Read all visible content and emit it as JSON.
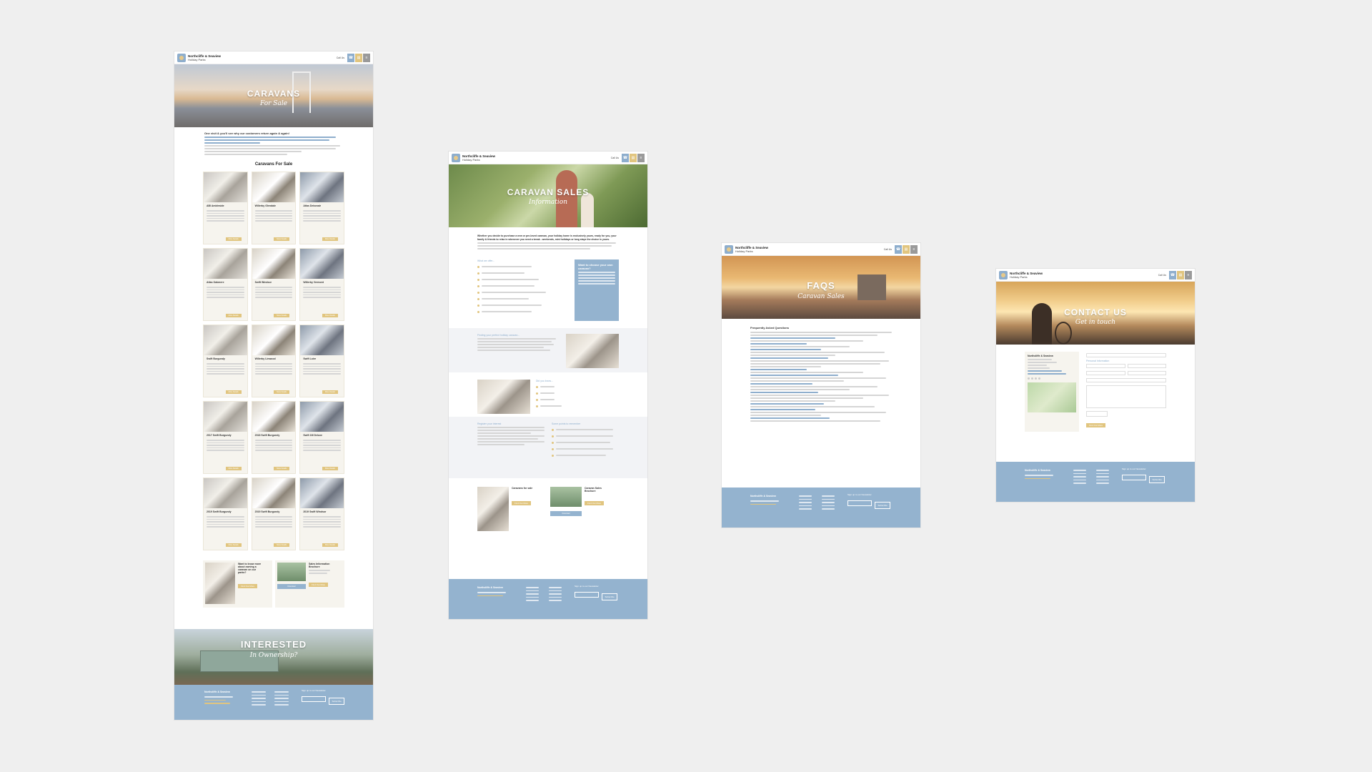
{
  "brand": {
    "name": "Northcliffe & Seaview",
    "sub": "Holiday Parks",
    "phone": "Call Us"
  },
  "icons": {
    "phone": "phone-icon",
    "brochure": "book-icon",
    "menu": "menu-icon"
  },
  "colors": {
    "blue": "#94b3cf",
    "gold": "#e1c57f",
    "grey": "#9a9a9a"
  },
  "board1": {
    "hero_title": "CARAVANS",
    "hero_script": "For Sale",
    "intro_heading": "One visit & you'll see why our customers return again & again!",
    "section_title": "Caravans For Sale",
    "cards": [
      {
        "name": "ABI Ambleside"
      },
      {
        "name": "Willerby Glendale"
      },
      {
        "name": "Atlas Debonair"
      },
      {
        "name": "Atlas Oakmere"
      },
      {
        "name": "Swift Windsor"
      },
      {
        "name": "Willerby Vermont"
      },
      {
        "name": "Swift Burgundy"
      },
      {
        "name": "Willerby Linwood"
      },
      {
        "name": "Swift Loire"
      },
      {
        "name": "2017 Swift Burgundy"
      },
      {
        "name": "2018 Swift Burgundy"
      },
      {
        "name": "Swift 1M Deluxe"
      },
      {
        "name": "2019 Swift Burgundy"
      },
      {
        "name": "2019 Swift Burgundy"
      },
      {
        "name": "2019 Swift Windsor"
      }
    ],
    "card_button": "More Details",
    "promo_q": "Want to know more about owning a caravan on our parks?",
    "promo_brochure": "Sales Information Brochure",
    "promo_btn": "Find Out More",
    "promo_btn2": "Download",
    "banner_title": "INTERESTED",
    "banner_script": "In Ownership?",
    "newsletter": "Sign up to our Newsletter",
    "subscribe": "Subscribe"
  },
  "board2": {
    "hero_title": "CARAVAN SALES",
    "hero_script": "Information",
    "intro_heading": "Whether you decide to purchase a new or pre-loved caravan, your holiday home is exclusively yours, ready for you, your family & friends to relax in whenever you need a break - weekends, mini holidays or long stays the choice is yours.",
    "we_offer": "What we offer...",
    "why_box": "Want to choose your own caravan?",
    "finding": "Finding your perfect holiday caravan...",
    "did_you_know": "Did you know...",
    "register": "Register your interest",
    "points": "Some points to remember",
    "caravans_for_sale": "Caravans for sale",
    "brochure": "Caravan Sales Brochure",
    "newsletter": "Sign up to our Newsletter",
    "subscribe": "Subscribe"
  },
  "board3": {
    "hero_title": "FAQS",
    "hero_script": "Caravan Sales",
    "faq_heading": "Frequently Asked Questions",
    "newsletter": "Sign up to our Newsletter",
    "subscribe": "Subscribe"
  },
  "board4": {
    "hero_title": "CONTACT US",
    "hero_script": "Get in touch",
    "side_title": "Northcliffe & Seaview",
    "form_title": "Personal Information",
    "newsletter": "Sign up to our Newsletter",
    "subscribe": "Subscribe"
  }
}
